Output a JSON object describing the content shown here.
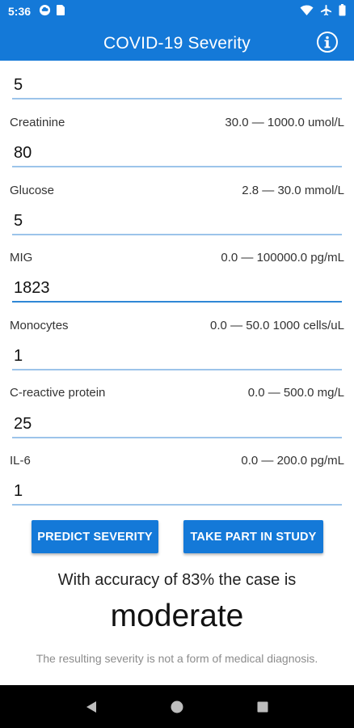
{
  "status_bar": {
    "time": "5:36"
  },
  "app_bar": {
    "title": "COVID-19 Severity"
  },
  "fields": [
    {
      "label": "",
      "range": "",
      "value": "5"
    },
    {
      "label": "Creatinine",
      "range": "30.0 — 1000.0 umol/L",
      "value": "80"
    },
    {
      "label": "Glucose",
      "range": "2.8 — 30.0 mmol/L",
      "value": "5"
    },
    {
      "label": "MIG",
      "range": "0.0 — 100000.0 pg/mL",
      "value": "1823"
    },
    {
      "label": "Monocytes",
      "range": "0.0 — 50.0 1000 cells/uL",
      "value": "1"
    },
    {
      "label": "C-reactive protein",
      "range": "0.0 — 500.0 mg/L",
      "value": "25"
    },
    {
      "label": "IL-6",
      "range": "0.0 — 200.0 pg/mL",
      "value": "1"
    }
  ],
  "buttons": {
    "predict": "PREDICT SEVERITY",
    "study": "TAKE PART IN STUDY"
  },
  "result": {
    "line": "With accuracy of 83% the case is",
    "severity": "moderate",
    "disclaimer": "The resulting severity is not a form of medical diagnosis."
  },
  "colors": {
    "primary": "#1479d8",
    "underline": "#9cc4ea",
    "underline_active": "#2f87d6"
  },
  "icons": {
    "status_left": [
      "cloud-icon",
      "sim-card-icon"
    ],
    "status_right": [
      "wifi-icon",
      "airplane-icon",
      "battery-icon"
    ],
    "app_bar": "info-icon",
    "nav": [
      "back-icon",
      "home-icon",
      "recents-icon"
    ]
  }
}
